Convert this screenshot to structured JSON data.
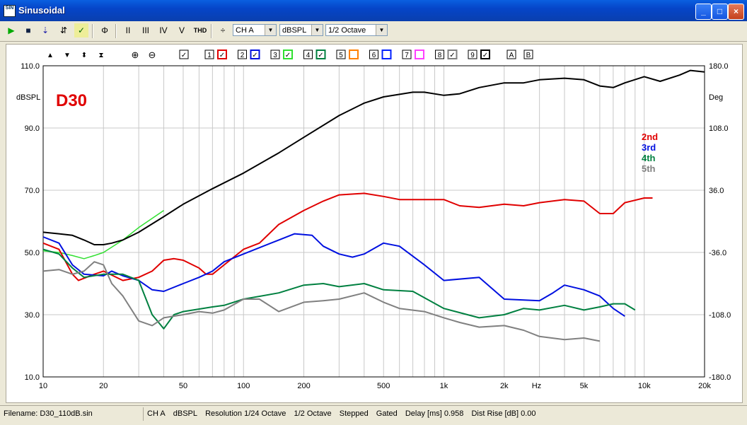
{
  "window": {
    "title": "Sinusoidal",
    "app_icon_text": "SIN",
    "min": "_",
    "max": "□",
    "close": "×"
  },
  "toolbar": {
    "channel": "CH A",
    "unit": "dBSPL",
    "smoothing": "1/2 Octave",
    "thd_label": "THD",
    "buttons": [
      "▶",
      "■",
      "⇣",
      "⇵",
      "✓",
      "Φ",
      "II",
      "III",
      "IV",
      "V"
    ]
  },
  "legend_bar": {
    "arrows": [
      "▲",
      "▼",
      "⬍",
      "⧗"
    ],
    "items": [
      {
        "label": "1",
        "color": "#e00000",
        "checked": true
      },
      {
        "label": "2",
        "color": "#0010e0",
        "checked": true
      },
      {
        "label": "3",
        "color": "#30e030",
        "checked": true
      },
      {
        "label": "4",
        "color": "#008040",
        "checked": true
      },
      {
        "label": "5",
        "color": "#ff8000",
        "checked": false
      },
      {
        "label": "6",
        "color": "#0020ff",
        "checked": false
      },
      {
        "label": "7",
        "color": "#ff40ff",
        "checked": false
      },
      {
        "label": "8",
        "color": "#808080",
        "checked": true
      },
      {
        "label": "9",
        "color": "#000000",
        "checked": true
      }
    ],
    "extra": [
      "A",
      "B"
    ]
  },
  "chart_data": {
    "type": "line",
    "title": "D30",
    "ylabel": "dBSPL",
    "y2label": "Deg",
    "xlabel": "Hz",
    "xscale": "log",
    "xlim": [
      10,
      20000
    ],
    "ylim": [
      10,
      110
    ],
    "y2lim": [
      -180,
      180
    ],
    "x_ticks": [
      "10",
      "20",
      "50",
      "100",
      "200",
      "500",
      "1k",
      "2k",
      "5k",
      "10k",
      "20k"
    ],
    "y_ticks": [
      "10.0",
      "30.0",
      "50.0",
      "70.0",
      "90.0",
      "110.0"
    ],
    "y2_ticks": [
      "-180.0",
      "-108.0",
      "-36.0",
      "36.0",
      "108.0",
      "180.0"
    ],
    "legend": [
      {
        "name": "2nd",
        "color": "#e00000"
      },
      {
        "name": "3rd",
        "color": "#0010e0"
      },
      {
        "name": "4th",
        "color": "#008040"
      },
      {
        "name": "5th",
        "color": "#808080"
      }
    ],
    "series": [
      {
        "id": "fund",
        "color": "#30e030",
        "width": 1.5,
        "points": [
          [
            10,
            50.5
          ],
          [
            12,
            50
          ],
          [
            14,
            49
          ],
          [
            16,
            48
          ],
          [
            18,
            49
          ],
          [
            20,
            50
          ],
          [
            25,
            54
          ],
          [
            30,
            58
          ],
          [
            40,
            63.5
          ]
        ]
      },
      {
        "id": "main",
        "color": "#000000",
        "width": 2,
        "points": [
          [
            10,
            56.5
          ],
          [
            12,
            56
          ],
          [
            14,
            55.5
          ],
          [
            16,
            54
          ],
          [
            18,
            52.5
          ],
          [
            20,
            52.5
          ],
          [
            22,
            53
          ],
          [
            25,
            54
          ],
          [
            30,
            56.5
          ],
          [
            40,
            61.5
          ],
          [
            50,
            65.5
          ],
          [
            70,
            70.5
          ],
          [
            100,
            75.5
          ],
          [
            150,
            82
          ],
          [
            200,
            87
          ],
          [
            300,
            94
          ],
          [
            400,
            98
          ],
          [
            500,
            100
          ],
          [
            700,
            101.5
          ],
          [
            800,
            101.5
          ],
          [
            1000,
            100.5
          ],
          [
            1200,
            101
          ],
          [
            1500,
            103
          ],
          [
            2000,
            104.5
          ],
          [
            2500,
            104.5
          ],
          [
            3000,
            105.5
          ],
          [
            4000,
            106
          ],
          [
            5000,
            105.5
          ],
          [
            6000,
            103.5
          ],
          [
            7000,
            103
          ],
          [
            8000,
            104.5
          ],
          [
            10000,
            106.5
          ],
          [
            12000,
            105
          ],
          [
            15000,
            107
          ],
          [
            17000,
            108.5
          ],
          [
            20000,
            108
          ]
        ]
      },
      {
        "id": "2nd",
        "color": "#e00000",
        "width": 2,
        "points": [
          [
            10,
            53
          ],
          [
            12,
            51
          ],
          [
            14,
            43
          ],
          [
            15,
            41
          ],
          [
            18,
            43
          ],
          [
            20,
            44
          ],
          [
            25,
            41
          ],
          [
            30,
            42
          ],
          [
            35,
            44
          ],
          [
            40,
            47.5
          ],
          [
            45,
            48
          ],
          [
            50,
            47.5
          ],
          [
            60,
            45
          ],
          [
            65,
            43
          ],
          [
            70,
            43
          ],
          [
            80,
            46
          ],
          [
            100,
            51
          ],
          [
            120,
            53
          ],
          [
            150,
            59
          ],
          [
            200,
            63.5
          ],
          [
            250,
            66.5
          ],
          [
            300,
            68.5
          ],
          [
            400,
            69
          ],
          [
            500,
            68
          ],
          [
            600,
            67
          ],
          [
            1000,
            67
          ],
          [
            1200,
            65
          ],
          [
            1500,
            64.5
          ],
          [
            2000,
            65.5
          ],
          [
            2500,
            65
          ],
          [
            3000,
            66
          ],
          [
            4000,
            67
          ],
          [
            5000,
            66.5
          ],
          [
            6000,
            62.5
          ],
          [
            7000,
            62.5
          ],
          [
            8000,
            66
          ],
          [
            10000,
            67.5
          ],
          [
            11000,
            67.5
          ]
        ]
      },
      {
        "id": "3rd",
        "color": "#0010e0",
        "width": 2,
        "points": [
          [
            10,
            55
          ],
          [
            12,
            53
          ],
          [
            14,
            46
          ],
          [
            16,
            43
          ],
          [
            20,
            42.5
          ],
          [
            22,
            44
          ],
          [
            25,
            42.5
          ],
          [
            30,
            41
          ],
          [
            35,
            38
          ],
          [
            40,
            37.5
          ],
          [
            50,
            40
          ],
          [
            60,
            42
          ],
          [
            70,
            44
          ],
          [
            80,
            47
          ],
          [
            100,
            49.5
          ],
          [
            150,
            54
          ],
          [
            180,
            56
          ],
          [
            220,
            55.5
          ],
          [
            250,
            52
          ],
          [
            300,
            49.5
          ],
          [
            350,
            48.5
          ],
          [
            400,
            49.5
          ],
          [
            500,
            53
          ],
          [
            600,
            52
          ],
          [
            800,
            46
          ],
          [
            1000,
            41
          ],
          [
            1500,
            42
          ],
          [
            2000,
            35
          ],
          [
            3000,
            34.5
          ],
          [
            3500,
            37
          ],
          [
            4000,
            39.5
          ],
          [
            5000,
            38
          ],
          [
            6000,
            36
          ],
          [
            7000,
            32
          ],
          [
            8000,
            29.5
          ]
        ]
      },
      {
        "id": "4th",
        "color": "#008040",
        "width": 2,
        "points": [
          [
            10,
            51
          ],
          [
            12,
            49.5
          ],
          [
            14,
            45
          ],
          [
            16,
            42
          ],
          [
            20,
            43
          ],
          [
            25,
            43
          ],
          [
            30,
            41
          ],
          [
            35,
            30
          ],
          [
            40,
            25.5
          ],
          [
            45,
            30
          ],
          [
            50,
            31
          ],
          [
            70,
            32.5
          ],
          [
            80,
            33
          ],
          [
            100,
            35
          ],
          [
            150,
            37
          ],
          [
            200,
            39.5
          ],
          [
            250,
            40
          ],
          [
            300,
            39
          ],
          [
            400,
            40
          ],
          [
            500,
            38
          ],
          [
            700,
            37.5
          ],
          [
            1000,
            32
          ],
          [
            1500,
            29
          ],
          [
            2000,
            30
          ],
          [
            2500,
            32
          ],
          [
            3000,
            31.5
          ],
          [
            4000,
            33
          ],
          [
            5000,
            31.5
          ],
          [
            6000,
            32.5
          ],
          [
            7000,
            33.5
          ],
          [
            8000,
            33.5
          ],
          [
            9000,
            31.5
          ]
        ]
      },
      {
        "id": "5th",
        "color": "#808080",
        "width": 2,
        "points": [
          [
            10,
            44
          ],
          [
            12,
            44.5
          ],
          [
            14,
            43
          ],
          [
            16,
            44
          ],
          [
            18,
            47
          ],
          [
            20,
            46
          ],
          [
            22,
            40
          ],
          [
            25,
            36
          ],
          [
            30,
            28
          ],
          [
            35,
            26.5
          ],
          [
            40,
            29
          ],
          [
            50,
            30
          ],
          [
            60,
            31
          ],
          [
            70,
            30.5
          ],
          [
            80,
            31.5
          ],
          [
            100,
            35
          ],
          [
            120,
            35
          ],
          [
            150,
            31
          ],
          [
            200,
            34
          ],
          [
            250,
            34.5
          ],
          [
            300,
            35
          ],
          [
            400,
            37
          ],
          [
            500,
            34
          ],
          [
            600,
            32
          ],
          [
            800,
            31
          ],
          [
            1000,
            29
          ],
          [
            1200,
            27.5
          ],
          [
            1500,
            26
          ],
          [
            2000,
            26.5
          ],
          [
            2500,
            25
          ],
          [
            3000,
            23
          ],
          [
            4000,
            22
          ],
          [
            5000,
            22.5
          ],
          [
            6000,
            21.5
          ]
        ]
      }
    ]
  },
  "status": {
    "filename": "Filename: D30_110dB.sin",
    "fields": [
      "CH A",
      "dBSPL",
      "Resolution 1/24 Octave",
      "1/2 Octave",
      "Stepped",
      "Gated",
      "Delay [ms] 0.958",
      "Dist Rise [dB] 0.00"
    ]
  }
}
